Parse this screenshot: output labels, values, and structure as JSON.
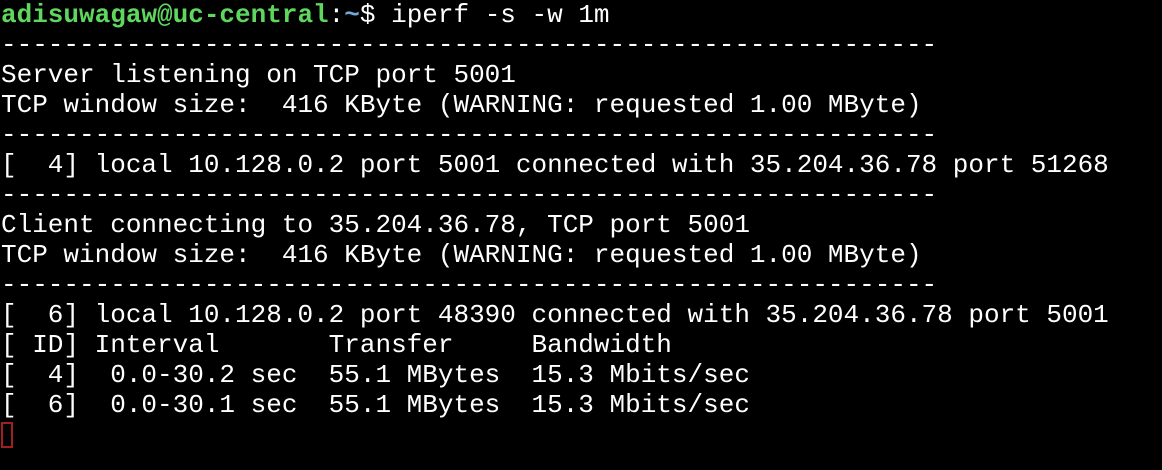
{
  "prompt": {
    "user_host": "adisuwagaw@uc-central",
    "separator": ":",
    "path": "~",
    "symbol": "$",
    "command": " iperf -s -w 1m"
  },
  "output_lines": [
    "------------------------------------------------------------",
    "Server listening on TCP port 5001",
    "TCP window size:  416 KByte (WARNING: requested 1.00 MByte)",
    "------------------------------------------------------------",
    "[  4] local 10.128.0.2 port 5001 connected with 35.204.36.78 port 51268",
    "------------------------------------------------------------",
    "Client connecting to 35.204.36.78, TCP port 5001",
    "TCP window size:  416 KByte (WARNING: requested 1.00 MByte)",
    "------------------------------------------------------------",
    "[  6] local 10.128.0.2 port 48390 connected with 35.204.36.78 port 5001",
    "[ ID] Interval       Transfer     Bandwidth",
    "[  4]  0.0-30.2 sec  55.1 MBytes  15.3 Mbits/sec",
    "[  6]  0.0-30.1 sec  55.1 MBytes  15.3 Mbits/sec"
  ],
  "colors": {
    "background": "#000000",
    "text": "#ffffff",
    "user_host": "#5fd75f",
    "path": "#6fa8dc",
    "cursor": "#a02020"
  }
}
